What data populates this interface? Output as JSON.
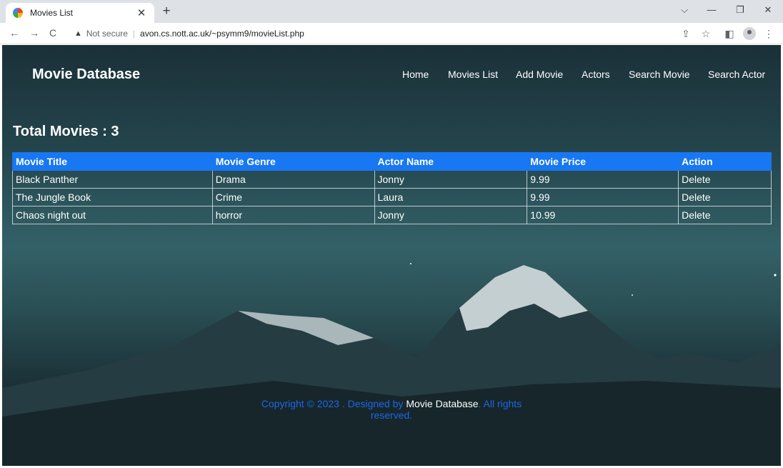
{
  "browser": {
    "tab_title": "Movies List",
    "tab_close": "✕",
    "new_tab": "+",
    "back": "←",
    "forward": "→",
    "reload": "C",
    "security_icon": "▲",
    "security_label": "Not secure",
    "separator": "|",
    "url": "avon.cs.nott.ac.uk/~psymm9/movieList.php",
    "minimize": "—",
    "maximize": "❐",
    "close": "✕",
    "tab_search": "⌵",
    "share": "⇪",
    "bookmark": "☆",
    "side_panel": "◧",
    "menu": "⋮"
  },
  "site": {
    "brand": "Movie Database",
    "nav": [
      "Home",
      "Movies List",
      "Add Movie",
      "Actors",
      "Search Movie",
      "Search Actor"
    ]
  },
  "main": {
    "heading": "Total Movies : 3",
    "table": {
      "headers": [
        "Movie Title",
        "Movie Genre",
        "Actor Name",
        "Movie Price",
        "Action"
      ],
      "rows": [
        [
          "Black Panther",
          "Drama",
          "Jonny",
          "9.99",
          "Delete"
        ],
        [
          "The Jungle Book",
          "Crime",
          "Laura",
          "9.99",
          "Delete"
        ],
        [
          "Chaos night out",
          "horror",
          "Jonny",
          "10.99",
          "Delete"
        ]
      ]
    }
  },
  "footer": {
    "prefix": "Copyright © 2023 . Designed by ",
    "site_name": "Movie Database",
    "suffix": ". All rights reserved."
  }
}
